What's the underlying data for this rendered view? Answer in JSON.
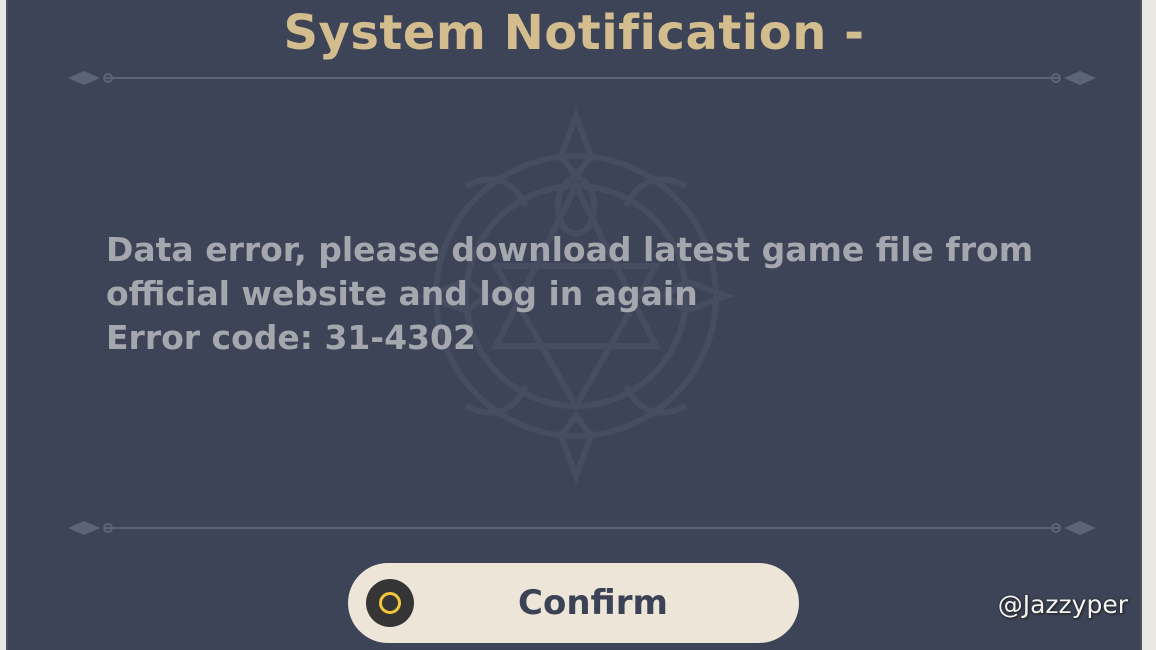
{
  "dialog": {
    "title": "System Notification -",
    "message_lines": [
      "Data error, please download latest game file from",
      "official website and log in again",
      "Error code: 31-4302"
    ],
    "confirm": {
      "label": "Confirm",
      "icon": "circle-button-icon"
    }
  },
  "watermark": "@Jazzyper",
  "colors": {
    "panel_background": "#3d4457",
    "title_gold": "#d3bc8e",
    "message_text": "#a4a7ae",
    "button_background": "#ece5d8",
    "button_text": "#3b4255",
    "icon_ring": "#f2c53b"
  }
}
